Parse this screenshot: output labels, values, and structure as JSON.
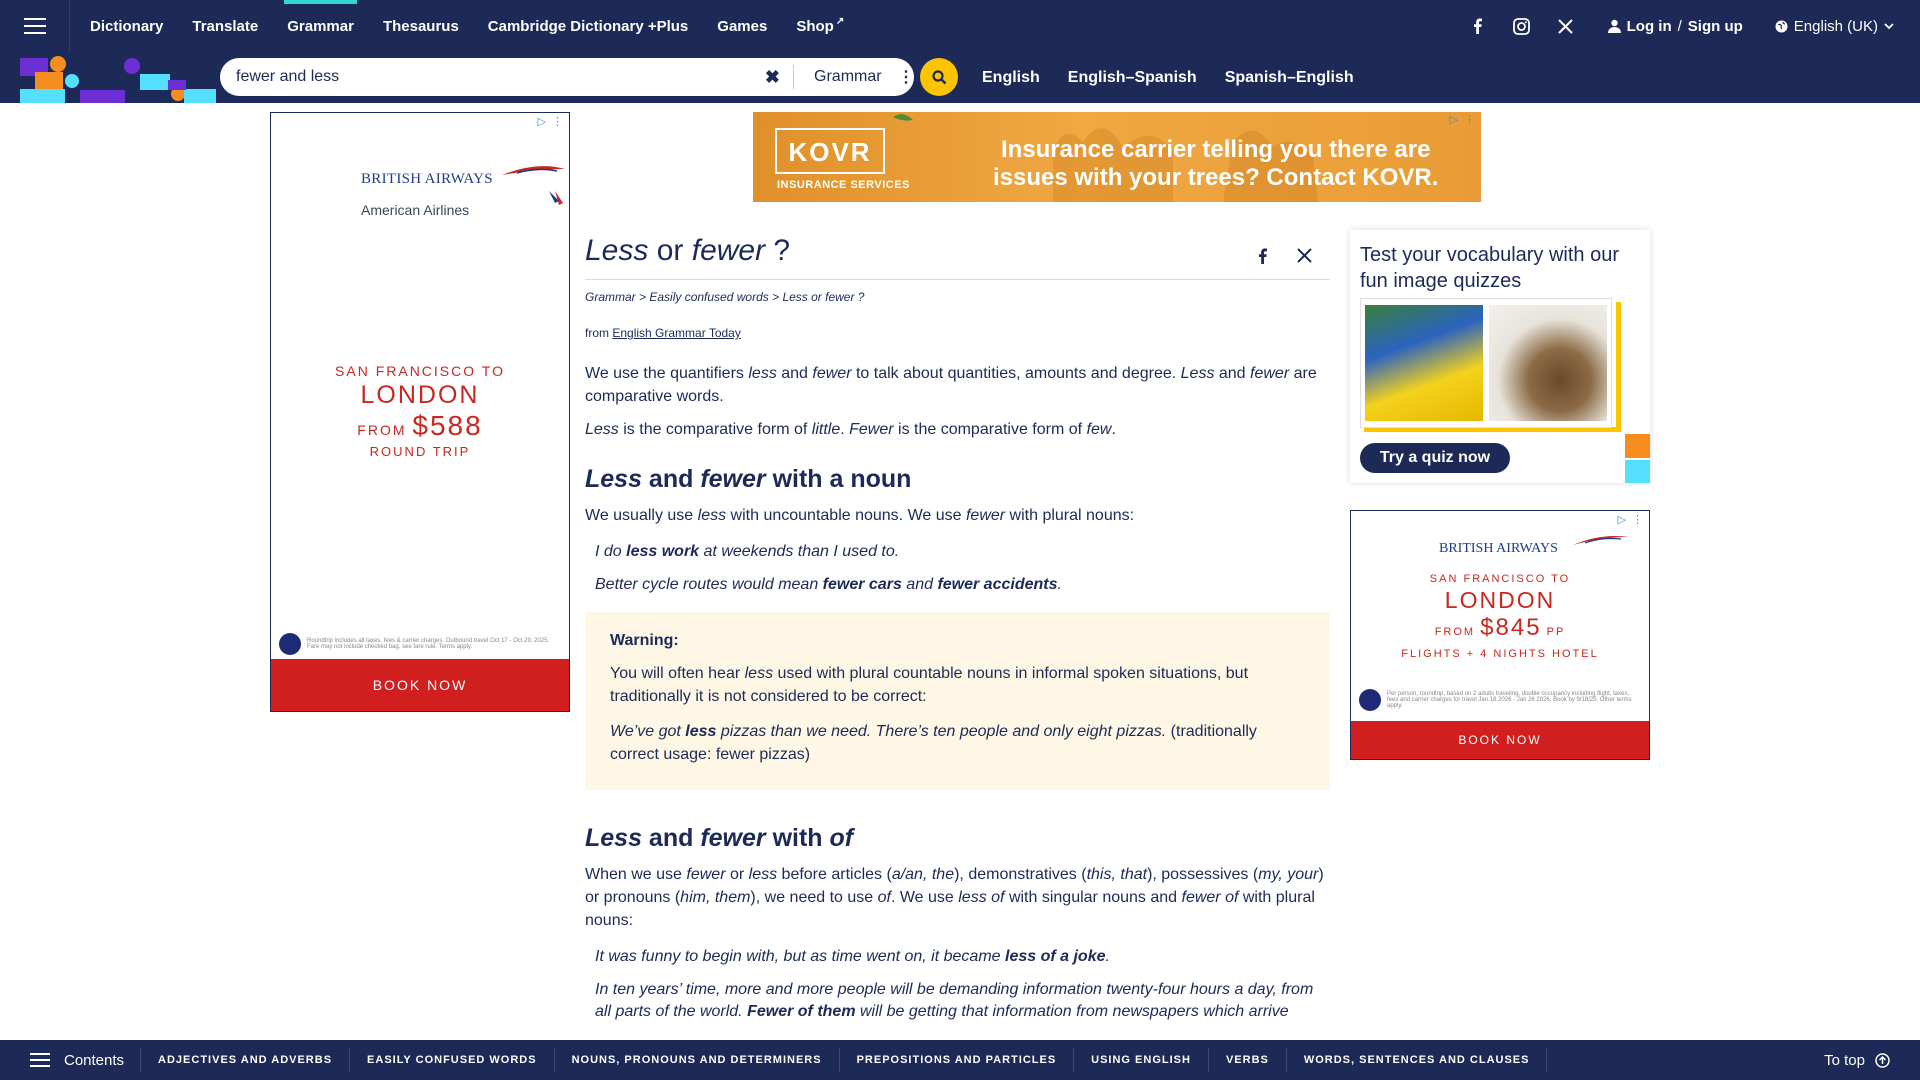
{
  "nav": {
    "links": [
      {
        "label": "Dictionary"
      },
      {
        "label": "Translate"
      },
      {
        "label": "Grammar",
        "active": true
      },
      {
        "label": "Thesaurus"
      },
      {
        "label": "Cambridge Dictionary +Plus"
      },
      {
        "label": "Games"
      },
      {
        "label": "Shop"
      }
    ],
    "login_label": "Log in",
    "login_sep": "/",
    "signup_label": "Sign up",
    "language": "English (UK)",
    "social_icons": [
      "facebook-icon",
      "instagram-icon",
      "x-icon"
    ]
  },
  "search": {
    "value": "fewer and less",
    "dictionary": "Grammar",
    "clear": "✖",
    "menu": "⋮"
  },
  "lang_links": [
    "English",
    "English–Spanish",
    "Spanish–English"
  ],
  "ad_left": {
    "brand1": "BRITISH AIRWAYS",
    "brand2": "American Airlines",
    "line1": "SAN FRANCISCO TO",
    "line2": "LONDON",
    "from": "FROM",
    "price": "$588",
    "line4": "ROUND TRIP",
    "fine": "Roundtrip includes all taxes, fees & carrier charges. Outbound travel Oct 17 - Oct 29, 2025. Fare may not include checked bag, see fare rule. Terms apply.",
    "cta": "BOOK NOW"
  },
  "banner": {
    "brand": "KOVR",
    "sub": "INSURANCE SERVICES",
    "message_line1": "Insurance carrier telling you there are",
    "message_line2": "issues with your trees? Contact KOVR."
  },
  "article": {
    "title_word1": "Less",
    "title_mid": " or ",
    "title_word2": "fewer",
    "title_end": " ?",
    "breadcrumb": [
      "Grammar",
      "Easily confused words",
      "Less or fewer ?"
    ],
    "breadcrumb_sep": " > ",
    "from_label": "from ",
    "from_link": "English Grammar Today",
    "intro1": {
      "a": "We use the quantifiers ",
      "b": "less",
      "c": " and ",
      "d": "fewer",
      "e": " to talk about quantities, amounts and degree. ",
      "f": "Less",
      "g": " and ",
      "h": "fewer",
      "i": " are comparative words."
    },
    "intro2": {
      "a": "Less",
      "b": " is the comparative form of ",
      "c": "little",
      "d": ". ",
      "e": "Fewer",
      "f": " is the comparative form of ",
      "g": "few",
      "h": "."
    },
    "section1": {
      "w1": "Less",
      "mid": " and ",
      "w2": "fewer",
      "end": " with a noun",
      "p": {
        "a": "We usually use ",
        "b": "less",
        "c": " with uncountable nouns. We use ",
        "d": "fewer",
        "e": " with plural nouns:"
      },
      "ex1": {
        "a": "I do ",
        "b": "less work",
        "c": " at weekends than I used to."
      },
      "ex2": {
        "a": "Better cycle routes would mean ",
        "b": "fewer cars",
        "c": " and ",
        "d": "fewer accidents",
        "e": "."
      }
    },
    "warning": {
      "title": "Warning:",
      "p": {
        "a": "You will often hear ",
        "b": "less",
        "c": " used with plural countable nouns in informal spoken situations, but traditionally it is not considered to be correct:"
      },
      "ex": {
        "a": "We’ve got ",
        "b": "less",
        "c": " pizzas than we need. There’s ten people and only eight pizzas.",
        "d": " (traditionally correct usage: fewer pizzas)"
      }
    },
    "section2": {
      "w1": "Less",
      "mid": " and ",
      "w2": "fewer",
      "end": " with ",
      "w3": "of",
      "p": {
        "a": "When we use ",
        "b": "fewer",
        "c": " or ",
        "d": "less",
        "e": " before articles (",
        "f": "a/an, the",
        "g": "), demonstratives (",
        "h": "this, that",
        "i": "), possessives (",
        "j": "my, your",
        "k": ") or pronouns (",
        "l": "him, them",
        "m": "), we need to use ",
        "n": "of",
        "o": ". We use ",
        "p": "less of",
        "q": " with singular nouns and ",
        "r": "fewer of",
        "s": " with plural nouns:"
      },
      "ex1": {
        "a": "It was funny to begin with, but as time went on, it became ",
        "b": "less of a joke",
        "c": "."
      },
      "ex2": {
        "a": "In ten years’ time, more and more people will be demanding information twenty-four hours a day, from all parts of the world. ",
        "b": "Fewer of them",
        "c": " will be getting that information from newspapers which arrive"
      }
    }
  },
  "quiz": {
    "title": "Test your vocabulary with our fun image quizzes",
    "cta": "Try a quiz now"
  },
  "ad_right": {
    "brand": "BRITISH AIRWAYS",
    "line1": "SAN FRANCISCO TO",
    "line2": "LONDON",
    "from": "FROM",
    "price": "$845",
    "pp": "PP",
    "line4": "FLIGHTS + 4 NIGHTS HOTEL",
    "fine": "Per person, roundtrip, based on 2 adults traveling, double occupancy including flight, taxes, fees and carrier charges for travel Jan 18 2026 - Jan 26 2026. Book by 9/18/25. Other terms apply.",
    "cta": "BOOK NOW"
  },
  "bottom": {
    "contents_label": "Contents",
    "categories": [
      "ADJECTIVES AND ADVERBS",
      "EASILY CONFUSED WORDS",
      "NOUNS, PRONOUNS AND DETERMINERS",
      "PREPOSITIONS AND PARTICLES",
      "USING ENGLISH",
      "VERBS",
      "WORDS, SENTENCES AND CLAUSES"
    ],
    "totop_label": "To top"
  },
  "colors": {
    "navy": "#1d2a57",
    "yellow": "#fec400",
    "cyan": "#33d6d6",
    "warning_bg": "#fef7e6",
    "ad_red": "#d11f1f"
  }
}
